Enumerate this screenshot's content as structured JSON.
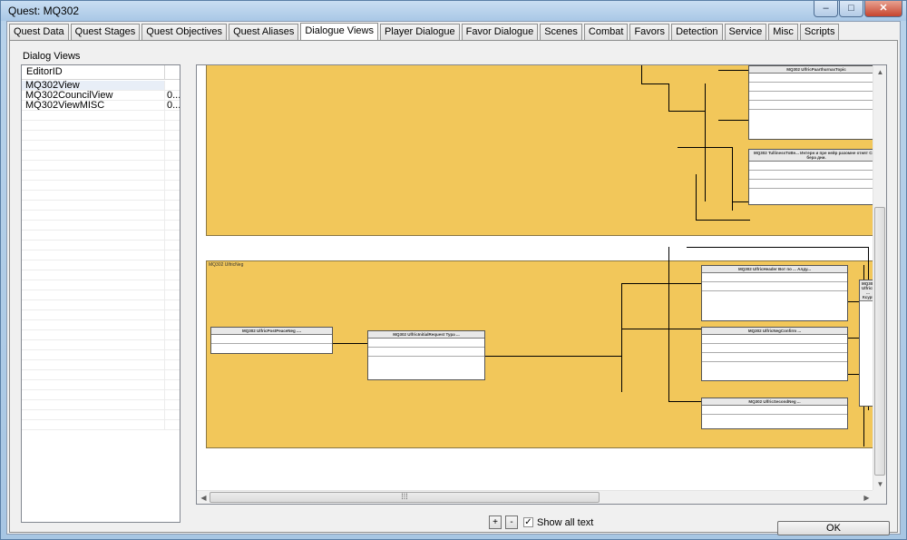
{
  "window": {
    "title": "Quest: MQ302",
    "controls": {
      "minimize": "–",
      "maximize": "□",
      "close": "✕"
    }
  },
  "tabs": [
    {
      "label": "Quest Data"
    },
    {
      "label": "Quest Stages"
    },
    {
      "label": "Quest Objectives"
    },
    {
      "label": "Quest Aliases"
    },
    {
      "label": "Dialogue Views",
      "active": true
    },
    {
      "label": "Player Dialogue"
    },
    {
      "label": "Favor Dialogue"
    },
    {
      "label": "Scenes"
    },
    {
      "label": "Combat"
    },
    {
      "label": "Favors"
    },
    {
      "label": "Detection"
    },
    {
      "label": "Service"
    },
    {
      "label": "Misc"
    },
    {
      "label": "Scripts"
    }
  ],
  "dialog_views": {
    "label": "Dialog Views",
    "columns": [
      "EditorID",
      ""
    ],
    "rows": [
      {
        "id": "MQ302View",
        "extra": ""
      },
      {
        "id": "MQ302CouncilView",
        "extra": "0..."
      },
      {
        "id": "MQ302ViewMISC",
        "extra": "0..."
      }
    ]
  },
  "canvas": {
    "branch2_title": "MQ302 UlfricNeg",
    "topics": {
      "t1_header": "MQ302 UlfricPaarthurnaxTopic",
      "t2_header": "MQ302 TullinessToBe... Интерн и пре нейр разомне отнят Скав бера дни.",
      "t3_header": "MQ302 UlfricHeader Вот по ... Алду...",
      "t4_header": "MQ302 UlfricPostPeaceNeg ....",
      "t5_header": "MQ302 UlfricInitialRequest Тура ...",
      "t6_header": "MQ302 UlfricFinal ... Ксур!",
      "t7_header": "MQ302 UlfricNegConfirm ...",
      "t8_header": "MQ302 UlfricSecondNeg ..."
    }
  },
  "bottom": {
    "plus": "+",
    "minus": "-",
    "show_all_text": "Show all text",
    "show_all_checked": "✓",
    "ok": "OK"
  }
}
